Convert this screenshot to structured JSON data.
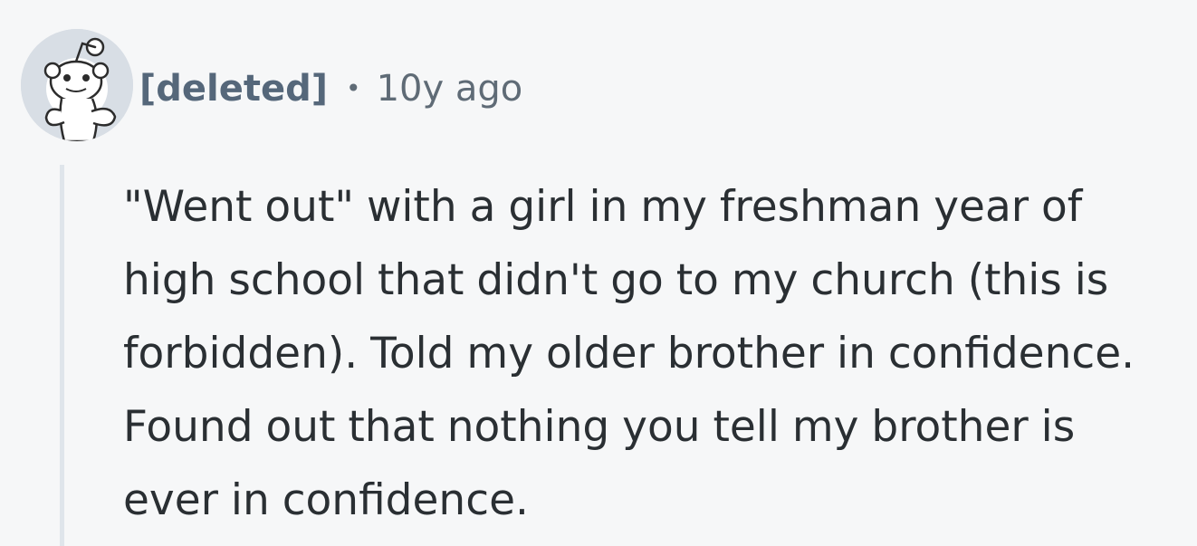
{
  "comment": {
    "author": "[deleted]",
    "separator": "•",
    "timestamp": "10y ago",
    "body": "\"Went out\" with a girl in my freshman year of high school that didn't go to my church (this is forbidden). Told my older brother in confidence. Found out that nothing you tell my brother is ever in confidence.",
    "avatar_icon": "reddit-snoo-avatar-icon"
  },
  "colors": {
    "background": "#f6f7f8",
    "author": "#55677a",
    "timestamp": "#5f6b76",
    "text": "#2a2f33",
    "thread_line": "#dfe5eb"
  }
}
